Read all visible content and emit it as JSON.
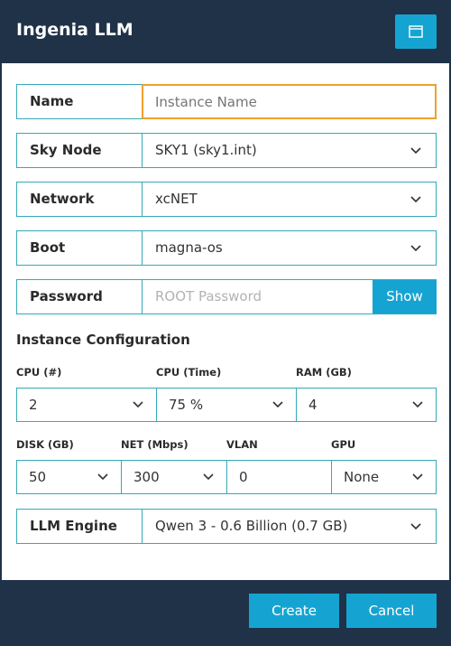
{
  "window": {
    "title": "Ingenia LLM",
    "header_icon": "window-icon"
  },
  "form": {
    "name": {
      "label": "Name",
      "placeholder": "Instance Name"
    },
    "sky_node": {
      "label": "Sky Node",
      "value": "SKY1 (sky1.int)"
    },
    "network": {
      "label": "Network",
      "value": "xcNET"
    },
    "boot": {
      "label": "Boot",
      "value": "magna-os"
    },
    "password": {
      "label": "Password",
      "placeholder": "ROOT Password",
      "show_label": "Show"
    },
    "llm_engine": {
      "label": "LLM Engine",
      "value": "Qwen 3 - 0.6 Billion (0.7 GB)"
    }
  },
  "instance_config": {
    "title": "Instance Configuration",
    "cpu": {
      "label": "CPU (#)",
      "value": "2"
    },
    "cpu_time": {
      "label": "CPU (Time)",
      "value": "75 %"
    },
    "ram": {
      "label": "RAM (GB)",
      "value": "4"
    },
    "disk": {
      "label": "DISK (GB)",
      "value": "50"
    },
    "net": {
      "label": "NET (Mbps)",
      "value": "300"
    },
    "vlan": {
      "label": "VLAN",
      "value": "0"
    },
    "gpu": {
      "label": "GPU",
      "value": "None"
    }
  },
  "footer": {
    "create_label": "Create",
    "cancel_label": "Cancel"
  },
  "colors": {
    "header_bg": "#1f3248",
    "accent": "#15a4d2",
    "border": "#36a9b8",
    "focus": "#f0a02c"
  }
}
